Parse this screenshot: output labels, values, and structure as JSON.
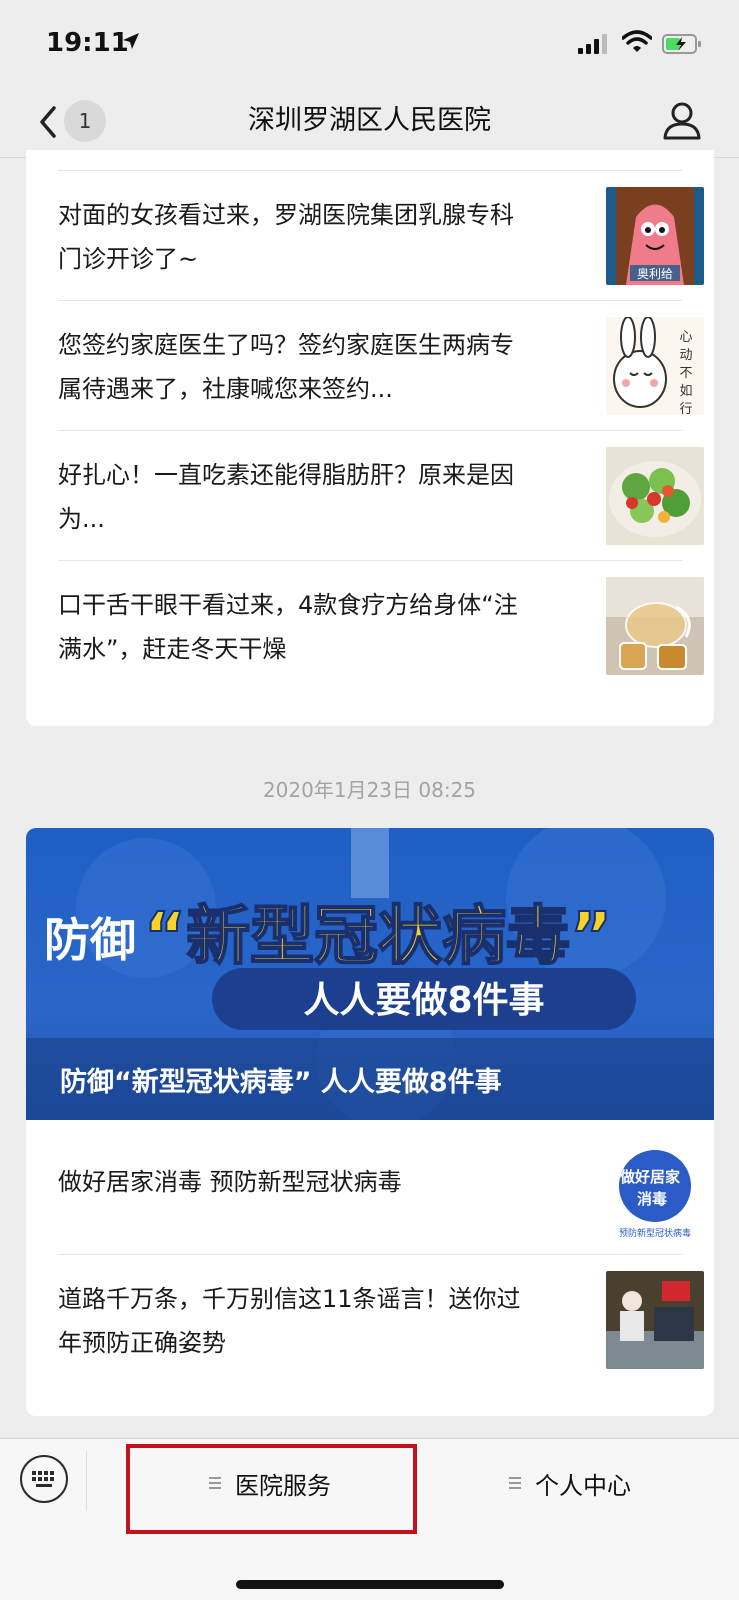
{
  "status_bar": {
    "time": "19:11"
  },
  "nav": {
    "back_badge": "1",
    "title": "深圳罗湖区人民医院"
  },
  "top_articles": [
    {
      "title": "对面的女孩看过来，罗湖医院集团乳腺专科门诊开诊了~",
      "thumb_label": "奥利给"
    },
    {
      "title": "您签约家庭医生了吗？签约家庭医生两病专属待遇来了，社康喊您来签约...",
      "thumb_label": "心动不如行动"
    },
    {
      "title": "好扎心！一直吃素还能得脂肪肝？原来是因为..."
    },
    {
      "title": "口干舌干眼干看过来，4款食疗方给身体“注满水”，赶走冬天干燥"
    }
  ],
  "date_stamp": "2020年1月23日 08:25",
  "featured": {
    "banner_line1_prefix": "防御",
    "banner_line1_main": "“新型冠状病毒”",
    "banner_line2": "人人要做8件事",
    "caption": "防御“新型冠状病毒” 人人要做8件事"
  },
  "bottom_articles": [
    {
      "title": "做好居家消毒 预防新型冠状病毒",
      "thumb_line1": "做好居家",
      "thumb_line2": "消毒",
      "thumb_caption": "预防新型冠状病毒"
    },
    {
      "title": "道路千万条，千万别信这11条谣言！送你过年预防正确姿势"
    }
  ],
  "tabs": {
    "hospital": "医院服务",
    "personal": "个人中心"
  },
  "colors": {
    "highlight": "#c1121c",
    "banner_blue": "#2a66c8",
    "banner_yellow": "#f5d327"
  }
}
